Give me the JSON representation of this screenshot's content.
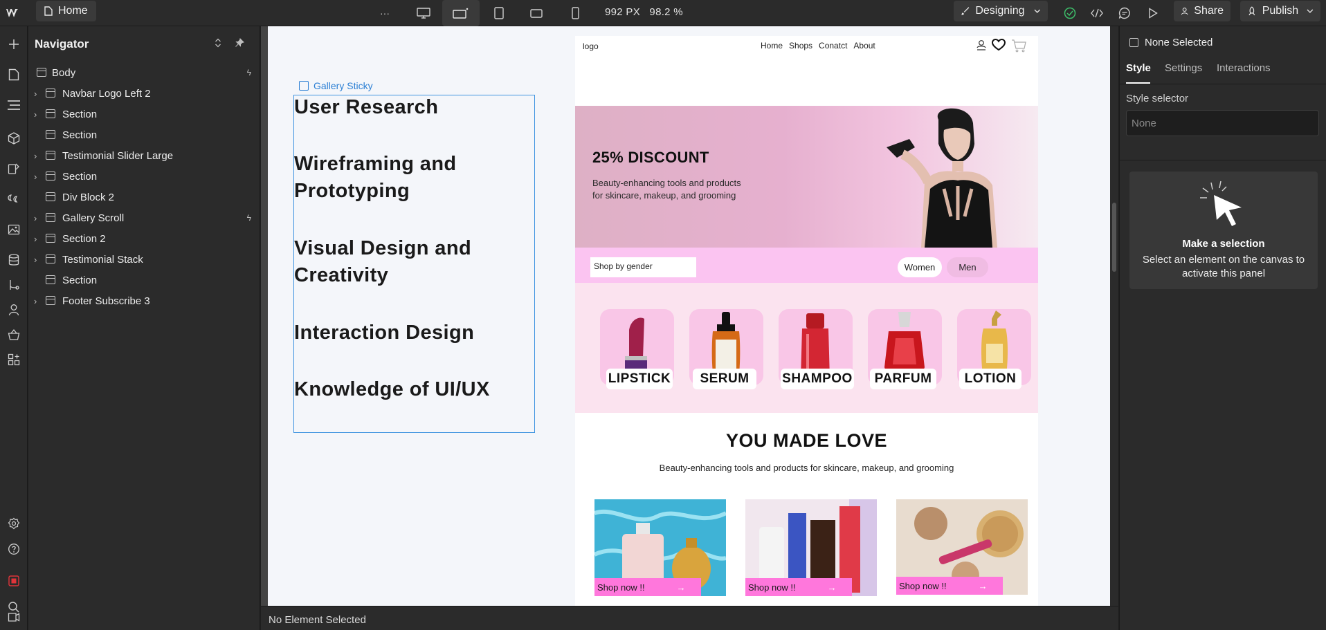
{
  "topbar": {
    "page_name": "Home",
    "more_label": "···",
    "canvas_width": "992 PX",
    "zoom": "98.2 %",
    "mode": "Designing",
    "share": "Share",
    "publish": "Publish"
  },
  "navigator": {
    "title": "Navigator",
    "items": [
      {
        "label": "Body",
        "has_children": false,
        "interaction": true
      },
      {
        "label": "Navbar Logo Left 2",
        "has_children": true,
        "interaction": false
      },
      {
        "label": "Section",
        "has_children": true,
        "interaction": false
      },
      {
        "label": "Section",
        "has_children": false,
        "interaction": false
      },
      {
        "label": "Testimonial Slider Large",
        "has_children": true,
        "interaction": false
      },
      {
        "label": "Section",
        "has_children": true,
        "interaction": false
      },
      {
        "label": "Div Block 2",
        "has_children": false,
        "interaction": false
      },
      {
        "label": "Gallery Scroll",
        "has_children": true,
        "interaction": true
      },
      {
        "label": "Section 2",
        "has_children": true,
        "interaction": false
      },
      {
        "label": "Testimonial Stack",
        "has_children": true,
        "interaction": false
      },
      {
        "label": "Section",
        "has_children": false,
        "interaction": false
      },
      {
        "label": "Footer Subscribe 3",
        "has_children": true,
        "interaction": false
      }
    ]
  },
  "gallery_sticky": {
    "tag": "Gallery Sticky",
    "items": [
      "User Research",
      "Wireframing and Prototyping",
      "Visual Design and Creativity",
      "Interaction Design",
      "Knowledge of UI/UX"
    ]
  },
  "site": {
    "logo": "logo",
    "nav": [
      "Home",
      "Shops",
      "Conatct",
      "About"
    ],
    "hero_title": "25% DISCOUNT",
    "hero_text": "Beauty-enhancing tools and products for skincare, makeup, and grooming",
    "shop_by": "Shop by gender",
    "gender_women": "Women",
    "gender_men": "Men",
    "categories": [
      "LIPSTICK",
      "SERUM",
      "SHAMPOO",
      "PARFUM",
      "LOTION"
    ],
    "section_title": "YOU MADE LOVE",
    "section_sub": "Beauty-enhancing tools and products for skincare, makeup, and grooming",
    "shop_now": "Shop now !!",
    "arrow": "→",
    "colors": {
      "accent": "#ff77dc",
      "gender_bar": "#fbc4f1",
      "category_bg": "#fbe3ef"
    }
  },
  "right_panel": {
    "selection": "None Selected",
    "tabs": [
      "Style",
      "Settings",
      "Interactions"
    ],
    "selector_label": "Style selector",
    "selector_value": "None",
    "card_title": "Make a selection",
    "card_text": "Select an element on the canvas to activate this panel"
  },
  "status": {
    "text": "No Element Selected"
  }
}
